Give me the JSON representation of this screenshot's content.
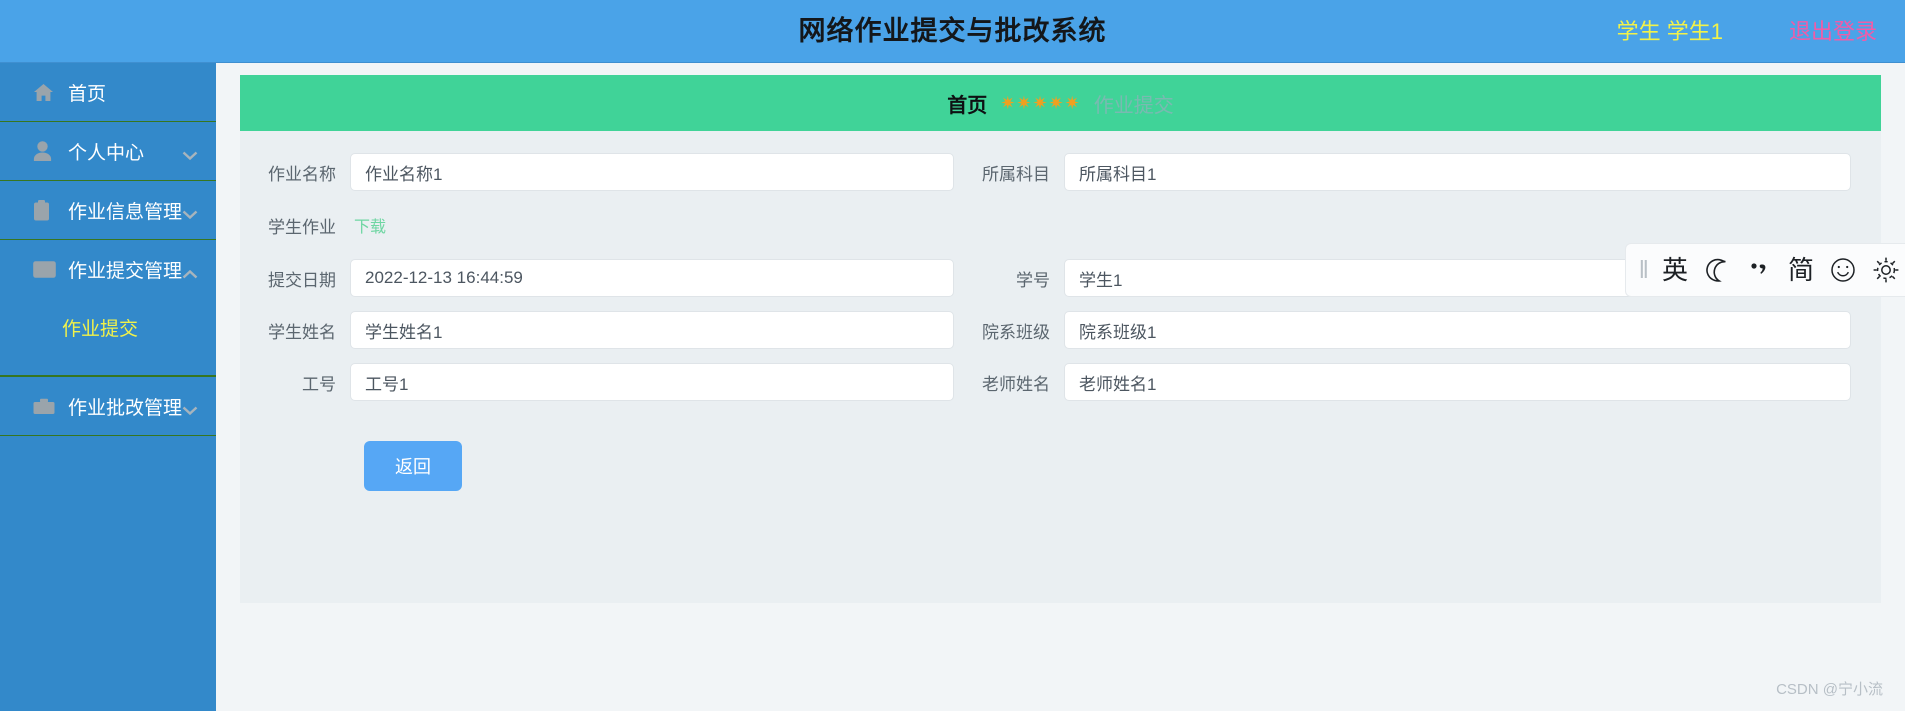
{
  "header": {
    "title": "网络作业提交与批改系统",
    "user": "学生 学生1",
    "logout": "退出登录",
    "bg_color": "#4aa3e8",
    "user_color": "#f2f249",
    "logout_color": "#f05ca8"
  },
  "sidebar": {
    "bg_color": "#3389ca",
    "active_color": "#f2f249",
    "items": [
      {
        "label": "首页",
        "icon": "home-icon",
        "arrow": "none"
      },
      {
        "label": "个人中心",
        "icon": "user-icon",
        "arrow": "chevron-down"
      },
      {
        "label": "作业信息管理",
        "icon": "clipboard-icon",
        "arrow": "chevron-down"
      },
      {
        "label": "作业提交管理",
        "icon": "mail-icon",
        "arrow": "chevron-up"
      },
      {
        "label": "作业批改管理",
        "icon": "briefcase-icon",
        "arrow": "chevron-down"
      }
    ],
    "submenu": [
      {
        "label": "作业提交",
        "active": true
      }
    ]
  },
  "banner": {
    "title": "首页",
    "stars": "✷✷✷✷✷",
    "subtitle": "作业提交",
    "bg_color": "#40d398"
  },
  "form": {
    "rows": [
      {
        "left": {
          "label": "作业名称",
          "value": "作业名称1"
        },
        "right": {
          "label": "所属科目",
          "value": "所属科目1"
        }
      },
      {
        "left": {
          "label": "提交日期",
          "value": "2022-12-13 16:44:59"
        },
        "right": {
          "label": "学号",
          "value": "学生1"
        }
      },
      {
        "left": {
          "label": "学生姓名",
          "value": "学生姓名1"
        },
        "right": {
          "label": "院系班级",
          "value": "院系班级1"
        }
      },
      {
        "left": {
          "label": "工号",
          "value": "工号1"
        },
        "right": {
          "label": "老师姓名",
          "value": "老师姓名1"
        }
      }
    ],
    "attachment": {
      "label": "学生作业",
      "link": "下载",
      "link_color": "#6fd6a3"
    },
    "back_button": "返回",
    "back_button_color": "#56a7f5"
  },
  "ime": {
    "grip": "⦀",
    "lang": "英",
    "mode": "简",
    "buttons": [
      "drag-handle",
      "英",
      "crescent-moon",
      "punctuation",
      "简",
      "smiley",
      "gear"
    ]
  },
  "watermark": "CSDN @宁小流"
}
